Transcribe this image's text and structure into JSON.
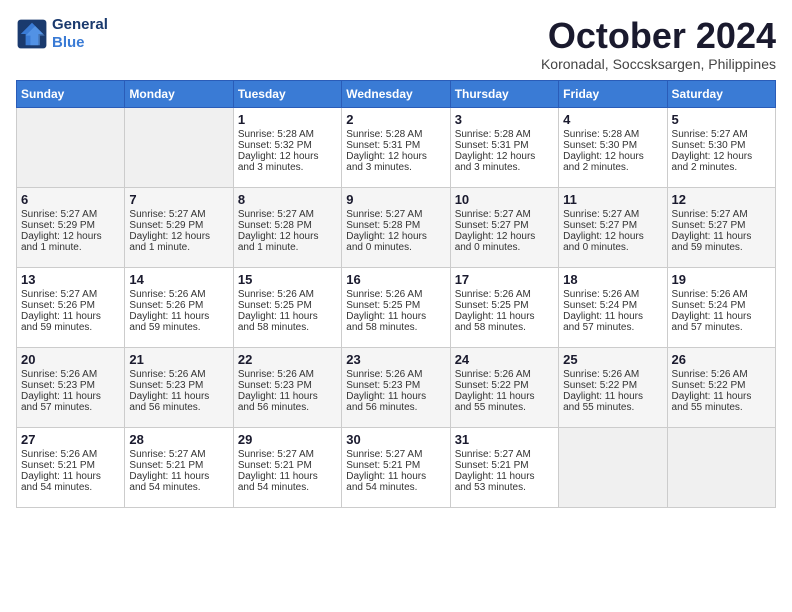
{
  "header": {
    "logo_line1": "General",
    "logo_line2": "Blue",
    "month": "October 2024",
    "location": "Koronadal, Soccsksargen, Philippines"
  },
  "days_of_week": [
    "Sunday",
    "Monday",
    "Tuesday",
    "Wednesday",
    "Thursday",
    "Friday",
    "Saturday"
  ],
  "weeks": [
    [
      {
        "day": "",
        "info": ""
      },
      {
        "day": "",
        "info": ""
      },
      {
        "day": "1",
        "info": "Sunrise: 5:28 AM\nSunset: 5:32 PM\nDaylight: 12 hours\nand 3 minutes."
      },
      {
        "day": "2",
        "info": "Sunrise: 5:28 AM\nSunset: 5:31 PM\nDaylight: 12 hours\nand 3 minutes."
      },
      {
        "day": "3",
        "info": "Sunrise: 5:28 AM\nSunset: 5:31 PM\nDaylight: 12 hours\nand 3 minutes."
      },
      {
        "day": "4",
        "info": "Sunrise: 5:28 AM\nSunset: 5:30 PM\nDaylight: 12 hours\nand 2 minutes."
      },
      {
        "day": "5",
        "info": "Sunrise: 5:27 AM\nSunset: 5:30 PM\nDaylight: 12 hours\nand 2 minutes."
      }
    ],
    [
      {
        "day": "6",
        "info": "Sunrise: 5:27 AM\nSunset: 5:29 PM\nDaylight: 12 hours\nand 1 minute."
      },
      {
        "day": "7",
        "info": "Sunrise: 5:27 AM\nSunset: 5:29 PM\nDaylight: 12 hours\nand 1 minute."
      },
      {
        "day": "8",
        "info": "Sunrise: 5:27 AM\nSunset: 5:28 PM\nDaylight: 12 hours\nand 1 minute."
      },
      {
        "day": "9",
        "info": "Sunrise: 5:27 AM\nSunset: 5:28 PM\nDaylight: 12 hours\nand 0 minutes."
      },
      {
        "day": "10",
        "info": "Sunrise: 5:27 AM\nSunset: 5:27 PM\nDaylight: 12 hours\nand 0 minutes."
      },
      {
        "day": "11",
        "info": "Sunrise: 5:27 AM\nSunset: 5:27 PM\nDaylight: 12 hours\nand 0 minutes."
      },
      {
        "day": "12",
        "info": "Sunrise: 5:27 AM\nSunset: 5:27 PM\nDaylight: 11 hours\nand 59 minutes."
      }
    ],
    [
      {
        "day": "13",
        "info": "Sunrise: 5:27 AM\nSunset: 5:26 PM\nDaylight: 11 hours\nand 59 minutes."
      },
      {
        "day": "14",
        "info": "Sunrise: 5:26 AM\nSunset: 5:26 PM\nDaylight: 11 hours\nand 59 minutes."
      },
      {
        "day": "15",
        "info": "Sunrise: 5:26 AM\nSunset: 5:25 PM\nDaylight: 11 hours\nand 58 minutes."
      },
      {
        "day": "16",
        "info": "Sunrise: 5:26 AM\nSunset: 5:25 PM\nDaylight: 11 hours\nand 58 minutes."
      },
      {
        "day": "17",
        "info": "Sunrise: 5:26 AM\nSunset: 5:25 PM\nDaylight: 11 hours\nand 58 minutes."
      },
      {
        "day": "18",
        "info": "Sunrise: 5:26 AM\nSunset: 5:24 PM\nDaylight: 11 hours\nand 57 minutes."
      },
      {
        "day": "19",
        "info": "Sunrise: 5:26 AM\nSunset: 5:24 PM\nDaylight: 11 hours\nand 57 minutes."
      }
    ],
    [
      {
        "day": "20",
        "info": "Sunrise: 5:26 AM\nSunset: 5:23 PM\nDaylight: 11 hours\nand 57 minutes."
      },
      {
        "day": "21",
        "info": "Sunrise: 5:26 AM\nSunset: 5:23 PM\nDaylight: 11 hours\nand 56 minutes."
      },
      {
        "day": "22",
        "info": "Sunrise: 5:26 AM\nSunset: 5:23 PM\nDaylight: 11 hours\nand 56 minutes."
      },
      {
        "day": "23",
        "info": "Sunrise: 5:26 AM\nSunset: 5:23 PM\nDaylight: 11 hours\nand 56 minutes."
      },
      {
        "day": "24",
        "info": "Sunrise: 5:26 AM\nSunset: 5:22 PM\nDaylight: 11 hours\nand 55 minutes."
      },
      {
        "day": "25",
        "info": "Sunrise: 5:26 AM\nSunset: 5:22 PM\nDaylight: 11 hours\nand 55 minutes."
      },
      {
        "day": "26",
        "info": "Sunrise: 5:26 AM\nSunset: 5:22 PM\nDaylight: 11 hours\nand 55 minutes."
      }
    ],
    [
      {
        "day": "27",
        "info": "Sunrise: 5:26 AM\nSunset: 5:21 PM\nDaylight: 11 hours\nand 54 minutes."
      },
      {
        "day": "28",
        "info": "Sunrise: 5:27 AM\nSunset: 5:21 PM\nDaylight: 11 hours\nand 54 minutes."
      },
      {
        "day": "29",
        "info": "Sunrise: 5:27 AM\nSunset: 5:21 PM\nDaylight: 11 hours\nand 54 minutes."
      },
      {
        "day": "30",
        "info": "Sunrise: 5:27 AM\nSunset: 5:21 PM\nDaylight: 11 hours\nand 54 minutes."
      },
      {
        "day": "31",
        "info": "Sunrise: 5:27 AM\nSunset: 5:21 PM\nDaylight: 11 hours\nand 53 minutes."
      },
      {
        "day": "",
        "info": ""
      },
      {
        "day": "",
        "info": ""
      }
    ]
  ]
}
